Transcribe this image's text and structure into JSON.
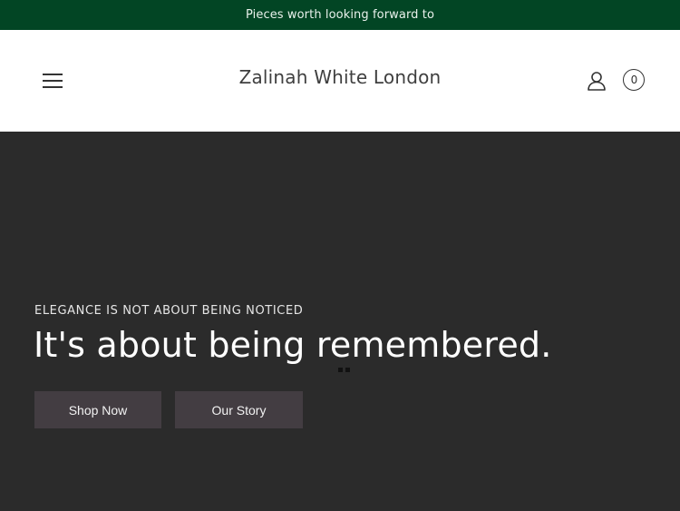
{
  "announcement": {
    "text": "Pieces worth looking forward to"
  },
  "header": {
    "brand": "Zalinah White London",
    "cart_count": "0",
    "icons": {
      "menu": "hamburger-menu-icon",
      "account": "user-account-icon",
      "cart": "cart-count-icon"
    }
  },
  "hero": {
    "eyebrow": "ELEGANCE IS NOT ABOUT BEING NOTICED",
    "heading": "It's about being remembered.",
    "buttons": {
      "shop": "Shop Now",
      "story": "Our Story"
    }
  },
  "colors": {
    "announcement_bg": "#024524",
    "hero_bg": "#2b2b2b",
    "button_bg": "#433d42",
    "header_bg": "#ffffff"
  }
}
